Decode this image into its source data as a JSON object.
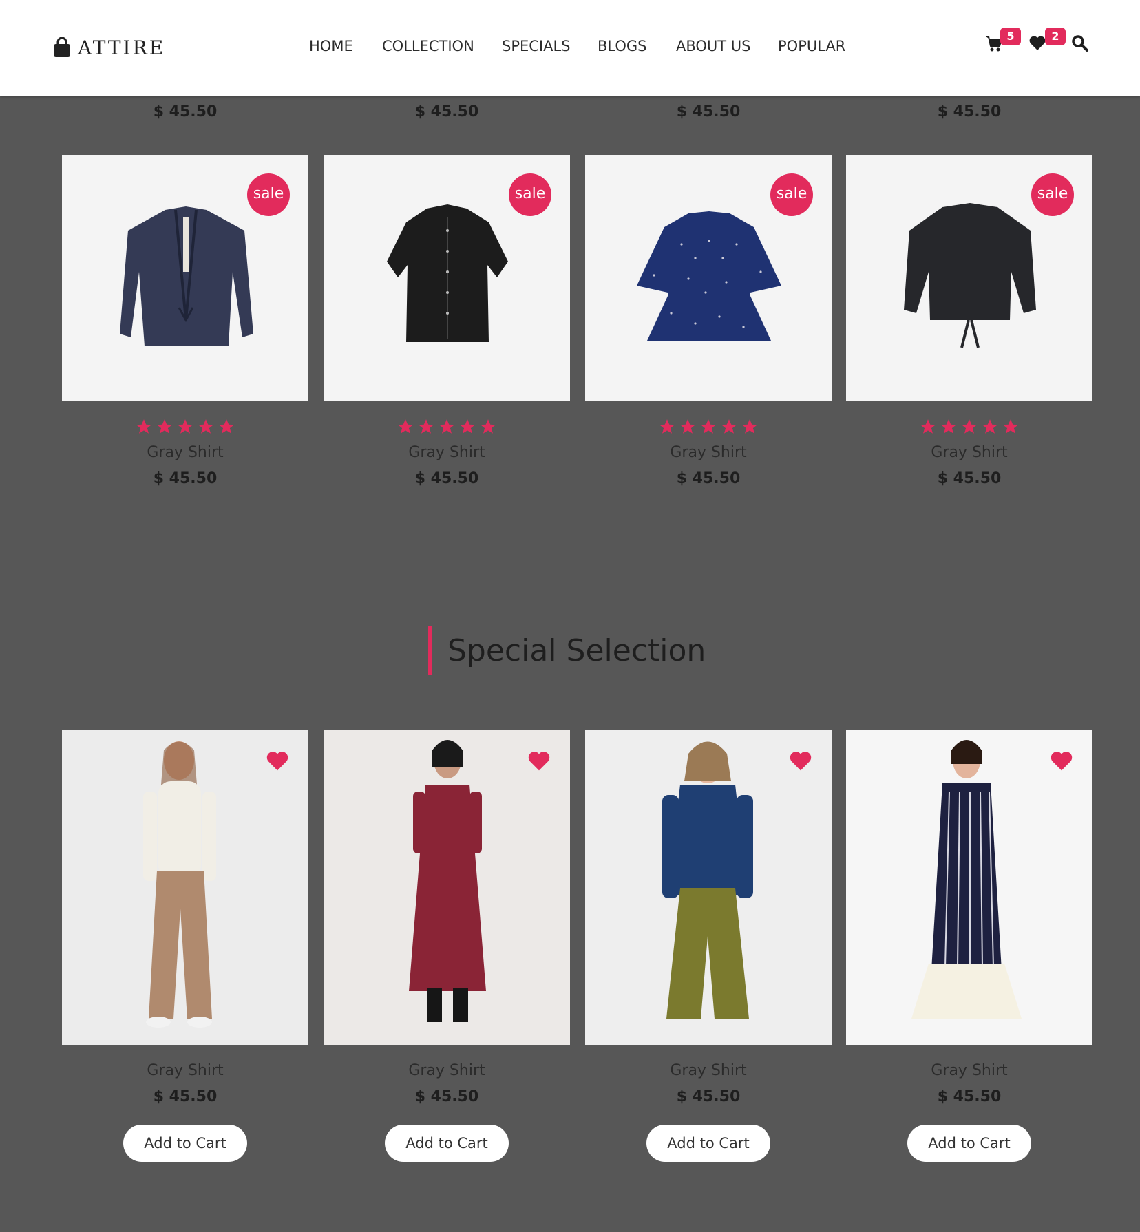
{
  "brand": {
    "name": "ATTIRE"
  },
  "nav": [
    "HOME",
    "COLLECTION",
    "SPECIALS",
    "BLOGS",
    "ABOUT US",
    "POPULAR"
  ],
  "actions": {
    "cart_count": "5",
    "wishlist_count": "2"
  },
  "top_row_prices": [
    "$ 45.50",
    "$ 45.50",
    "$ 45.50",
    "$ 45.50"
  ],
  "sale_products": [
    {
      "badge": "sale",
      "name": "Gray Shirt",
      "price": "$ 45.50",
      "rating": 5,
      "image": "navy-jacket"
    },
    {
      "badge": "sale",
      "name": "Gray Shirt",
      "price": "$ 45.50",
      "rating": 5,
      "image": "black-shirt"
    },
    {
      "badge": "sale",
      "name": "Gray Shirt",
      "price": "$ 45.50",
      "rating": 5,
      "image": "polka-dot-top"
    },
    {
      "badge": "sale",
      "name": "Gray Shirt",
      "price": "$ 45.50",
      "rating": 5,
      "image": "black-batwing-top"
    }
  ],
  "special_section": {
    "title": "Special Selection",
    "products": [
      {
        "name": "Gray Shirt",
        "price": "$ 45.50",
        "button": "Add to Cart",
        "image": "white-turtleneck-brown-trousers"
      },
      {
        "name": "Gray Shirt",
        "price": "$ 45.50",
        "button": "Add to Cart",
        "image": "maroon-kurta"
      },
      {
        "name": "Gray Shirt",
        "price": "$ 45.50",
        "button": "Add to Cart",
        "image": "denim-jacket-olive-pants"
      },
      {
        "name": "Gray Shirt",
        "price": "$ 45.50",
        "button": "Add to Cart",
        "image": "striped-navy-kurta"
      }
    ]
  },
  "colors": {
    "accent": "#e22b5c",
    "background": "#575757",
    "header": "#ffffff"
  }
}
